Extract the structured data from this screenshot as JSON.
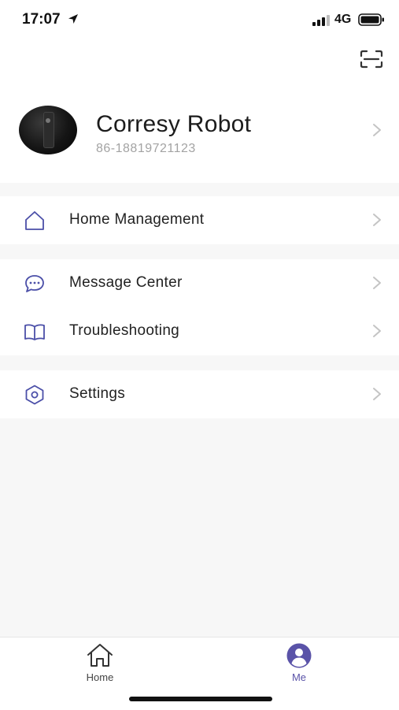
{
  "status_bar": {
    "time": "17:07",
    "network": "4G"
  },
  "profile": {
    "name": "Corresy Robot",
    "phone": "86-18819721123"
  },
  "menu": {
    "home_management": "Home Management",
    "message_center": "Message Center",
    "troubleshooting": "Troubleshooting",
    "settings": "Settings"
  },
  "tabs": {
    "home": "Home",
    "me": "Me",
    "active": "me"
  },
  "colors": {
    "accent": "#5a53a8",
    "icon_purple": "#4b4fa8",
    "chevron": "#c4c4c4",
    "background": "#f7f7f7"
  },
  "icons": {
    "scan": "scan-icon",
    "home_management": "home-icon",
    "message_center": "chat-bubble-icon",
    "troubleshooting": "book-icon",
    "settings": "hexagon-gear-icon"
  }
}
